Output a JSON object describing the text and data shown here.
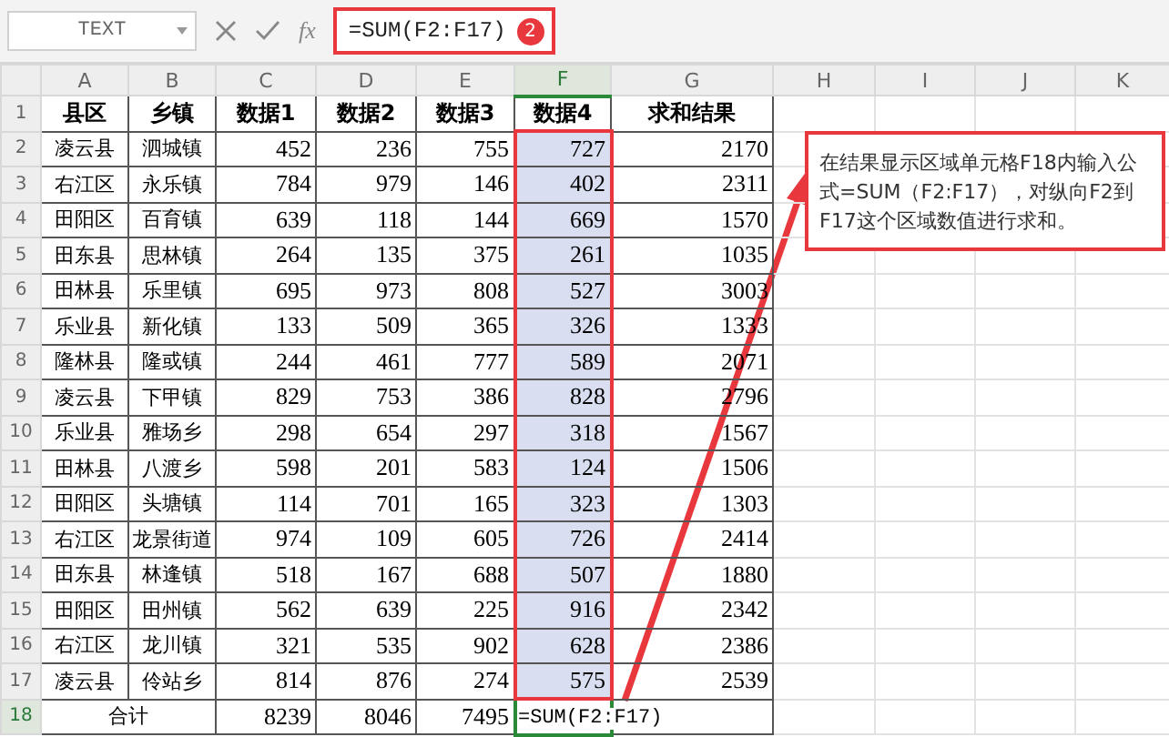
{
  "formula_bar": {
    "name_box": "TEXT",
    "function_label": "fx",
    "formula": "=SUM(F2:F17)",
    "step_badge": "2"
  },
  "columns": [
    {
      "label": "A",
      "selected": false
    },
    {
      "label": "B",
      "selected": false
    },
    {
      "label": "C",
      "selected": false
    },
    {
      "label": "D",
      "selected": false
    },
    {
      "label": "E",
      "selected": false
    },
    {
      "label": "F",
      "selected": true
    },
    {
      "label": "G",
      "selected": false
    },
    {
      "label": "H",
      "selected": false
    },
    {
      "label": "I",
      "selected": false
    },
    {
      "label": "J",
      "selected": false
    },
    {
      "label": "K",
      "selected": false
    }
  ],
  "rows": [
    {
      "number": "1",
      "kind": "header",
      "selected": false,
      "in_range": false,
      "cells": [
        "县区",
        "乡镇",
        "数据1",
        "数据2",
        "数据3",
        "数据4",
        "求和结果"
      ]
    },
    {
      "number": "2",
      "kind": "data",
      "selected": false,
      "in_range": true,
      "cells": [
        "凌云县",
        "泗城镇",
        "452",
        "236",
        "755",
        "727",
        "2170"
      ]
    },
    {
      "number": "3",
      "kind": "data",
      "selected": false,
      "in_range": true,
      "cells": [
        "右江区",
        "永乐镇",
        "784",
        "979",
        "146",
        "402",
        "2311"
      ]
    },
    {
      "number": "4",
      "kind": "data",
      "selected": false,
      "in_range": true,
      "cells": [
        "田阳区",
        "百育镇",
        "639",
        "118",
        "144",
        "669",
        "1570"
      ]
    },
    {
      "number": "5",
      "kind": "data",
      "selected": false,
      "in_range": true,
      "cells": [
        "田东县",
        "思林镇",
        "264",
        "135",
        "375",
        "261",
        "1035"
      ]
    },
    {
      "number": "6",
      "kind": "data",
      "selected": false,
      "in_range": true,
      "cells": [
        "田林县",
        "乐里镇",
        "695",
        "973",
        "808",
        "527",
        "3003"
      ]
    },
    {
      "number": "7",
      "kind": "data",
      "selected": false,
      "in_range": true,
      "cells": [
        "乐业县",
        "新化镇",
        "133",
        "509",
        "365",
        "326",
        "1333"
      ]
    },
    {
      "number": "8",
      "kind": "data",
      "selected": false,
      "in_range": true,
      "cells": [
        "隆林县",
        "隆或镇",
        "244",
        "461",
        "777",
        "589",
        "2071"
      ]
    },
    {
      "number": "9",
      "kind": "data",
      "selected": false,
      "in_range": true,
      "cells": [
        "凌云县",
        "下甲镇",
        "829",
        "753",
        "386",
        "828",
        "2796"
      ]
    },
    {
      "number": "10",
      "kind": "data",
      "selected": false,
      "in_range": true,
      "cells": [
        "乐业县",
        "雅场乡",
        "298",
        "654",
        "297",
        "318",
        "1567"
      ]
    },
    {
      "number": "11",
      "kind": "data",
      "selected": false,
      "in_range": true,
      "cells": [
        "田林县",
        "八渡乡",
        "598",
        "201",
        "583",
        "124",
        "1506"
      ]
    },
    {
      "number": "12",
      "kind": "data",
      "selected": false,
      "in_range": true,
      "cells": [
        "田阳区",
        "头塘镇",
        "114",
        "701",
        "165",
        "323",
        "1303"
      ]
    },
    {
      "number": "13",
      "kind": "data",
      "selected": false,
      "in_range": true,
      "cells": [
        "右江区",
        "龙景街道",
        "974",
        "109",
        "605",
        "726",
        "2414"
      ]
    },
    {
      "number": "14",
      "kind": "data",
      "selected": false,
      "in_range": true,
      "cells": [
        "田东县",
        "林逢镇",
        "518",
        "167",
        "688",
        "507",
        "1880"
      ]
    },
    {
      "number": "15",
      "kind": "data",
      "selected": false,
      "in_range": true,
      "cells": [
        "田阳区",
        "田州镇",
        "562",
        "639",
        "225",
        "916",
        "2342"
      ]
    },
    {
      "number": "16",
      "kind": "data",
      "selected": false,
      "in_range": true,
      "cells": [
        "右江区",
        "龙川镇",
        "321",
        "535",
        "902",
        "628",
        "2386"
      ]
    },
    {
      "number": "17",
      "kind": "data",
      "selected": false,
      "in_range": true,
      "cells": [
        "凌云县",
        "伶站乡",
        "814",
        "876",
        "274",
        "575",
        "2539"
      ]
    },
    {
      "number": "18",
      "kind": "total",
      "selected": true,
      "in_range": false,
      "cells": [
        "合计",
        "8239",
        "8046",
        "7495",
        "=SUM(F2:F17)"
      ]
    }
  ],
  "callout": {
    "text": "在结果显示区域单元格F18内输入公式=SUM（F2:F17），对纵向F2到F17这个区域数值进行求和。"
  }
}
